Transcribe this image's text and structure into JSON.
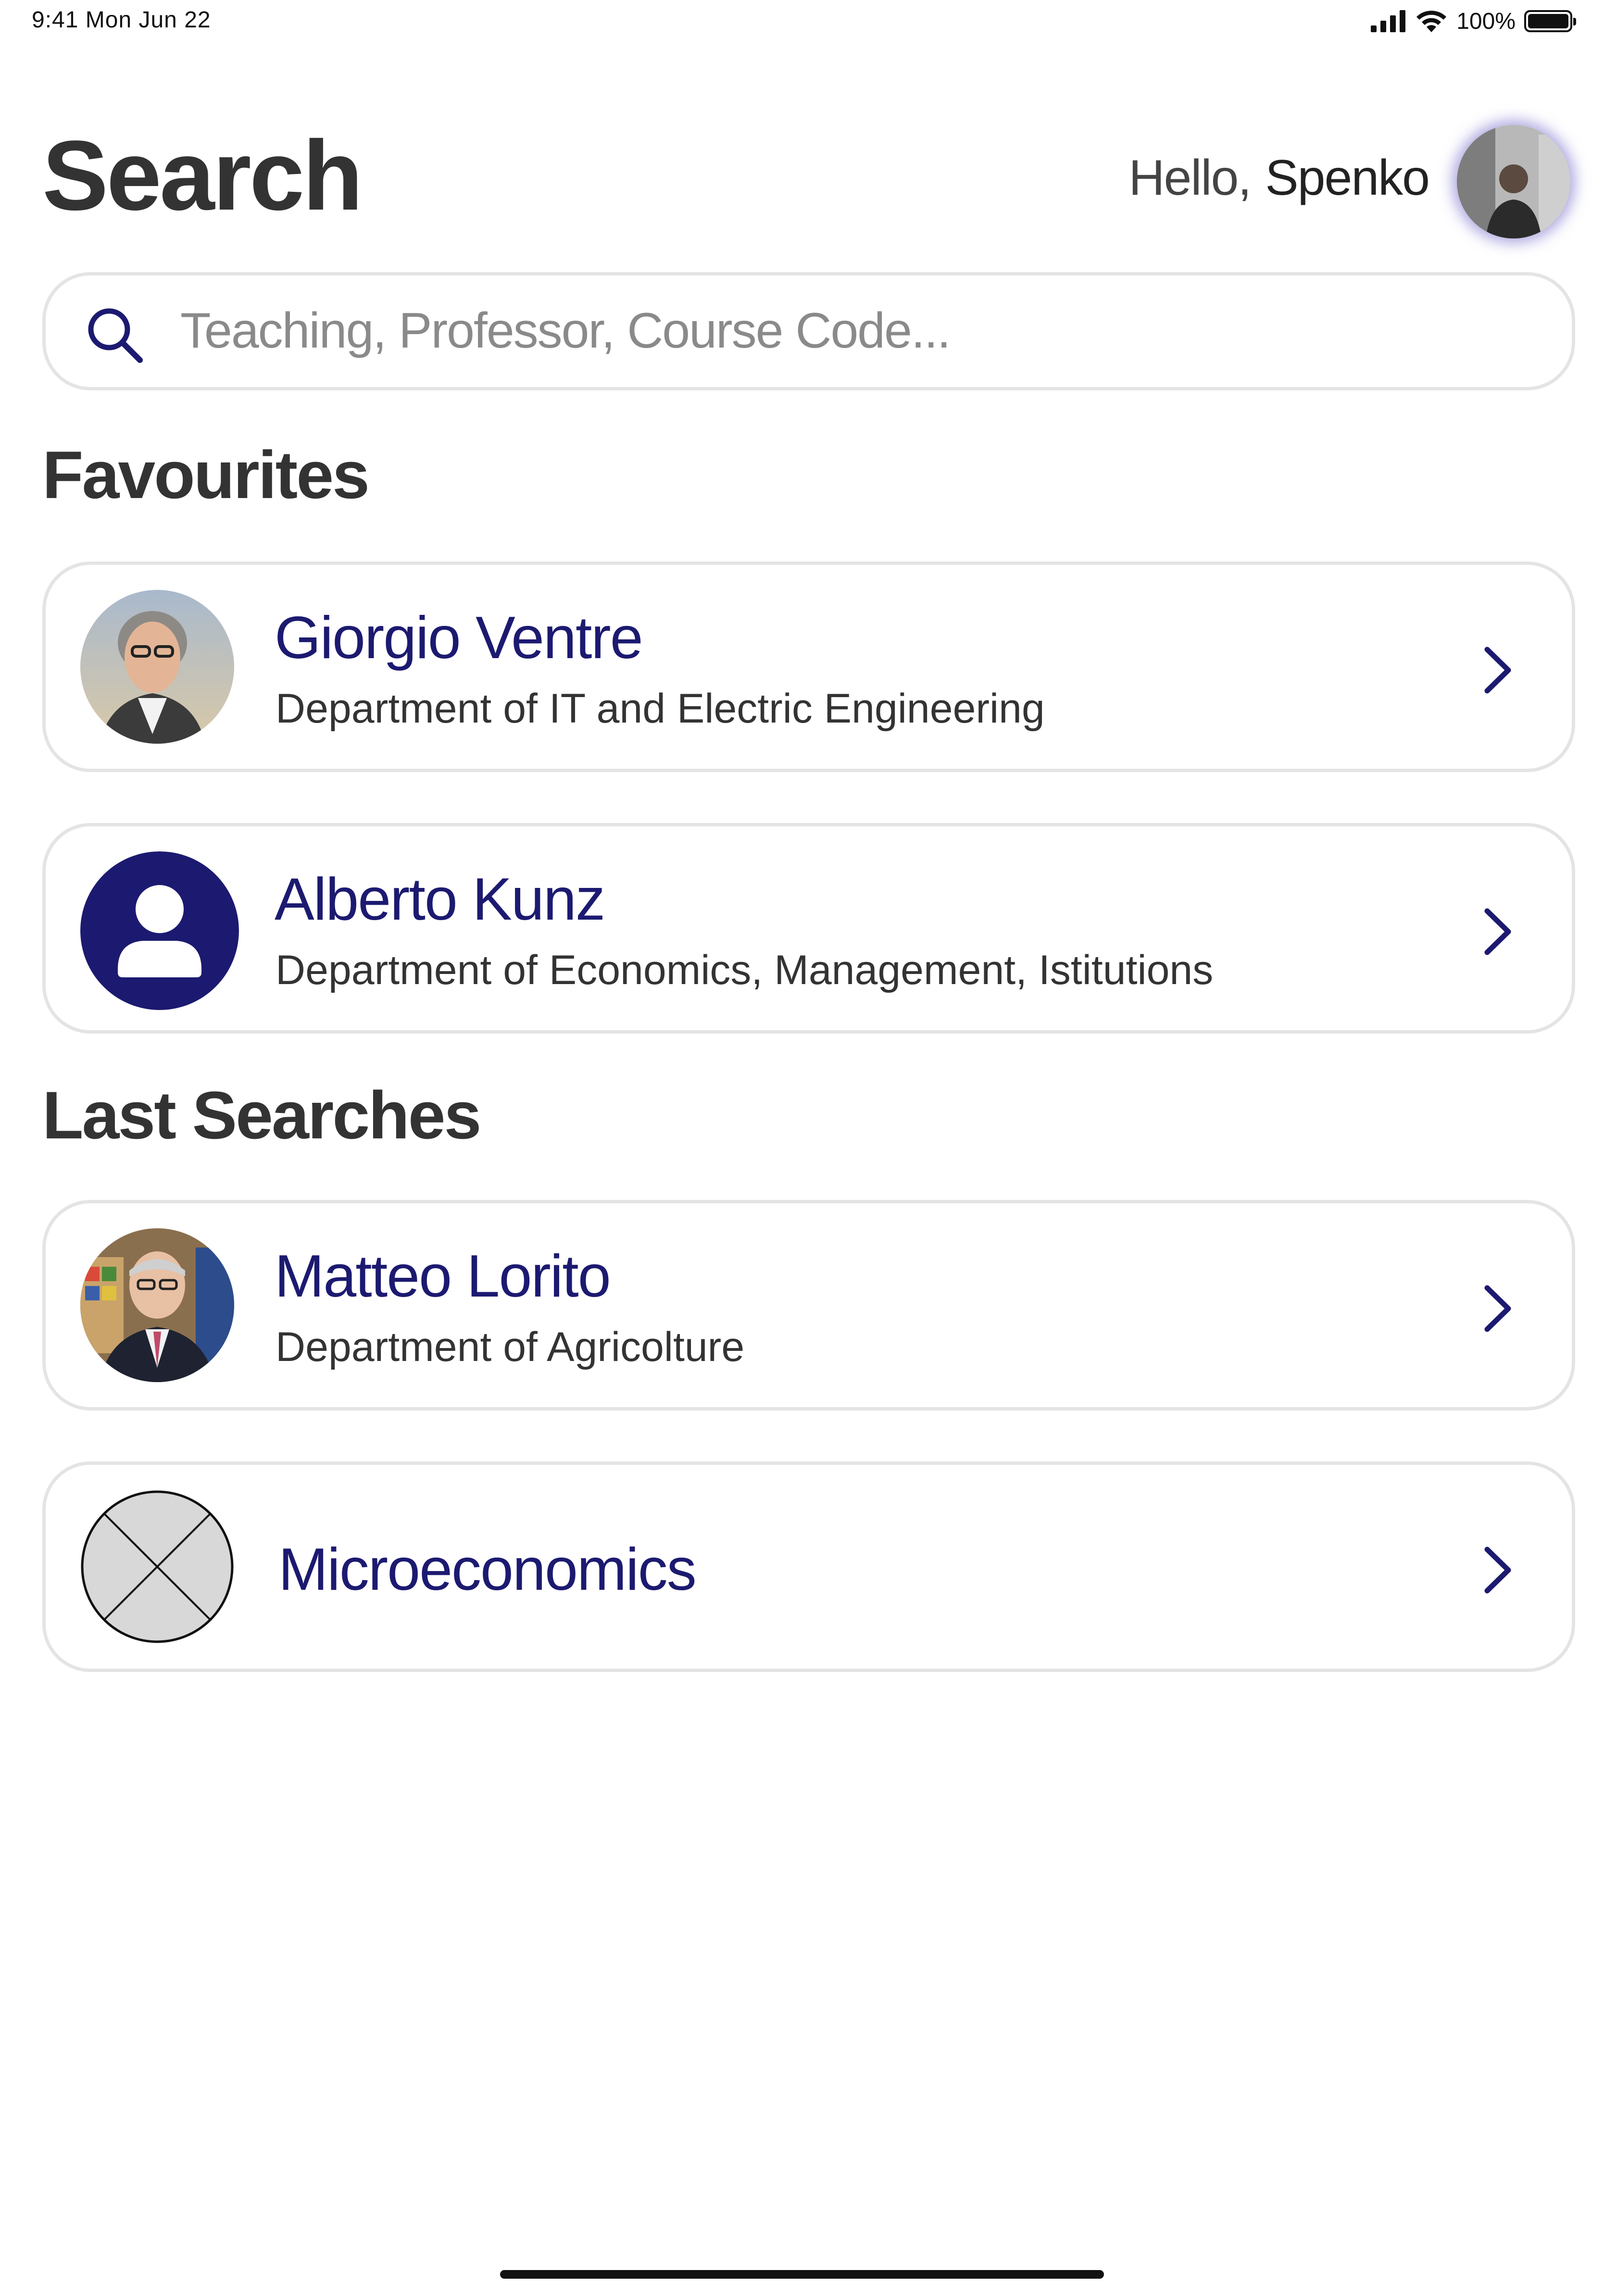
{
  "status_bar": {
    "time_date": "9:41  Mon Jun 22",
    "battery_pct": "100%",
    "battery_level": 1.0
  },
  "header": {
    "title": "Search",
    "greeting_prefix": "Hello,",
    "user_name": "Spenko",
    "avatar_icon": "user-photo"
  },
  "search": {
    "placeholder": "Teaching, Professor, Course Code...",
    "value": "",
    "icon": "search-icon",
    "accent": "#1c1a70"
  },
  "favourites": {
    "title": "Favourites",
    "items": [
      {
        "name": "Giorgio Ventre",
        "department": "Department of IT and Electric Engineering",
        "avatar": "professor-photo"
      },
      {
        "name": "Alberto Kunz",
        "department": "Department of Economics, Management, Istitutions",
        "avatar": "person-placeholder-icon"
      }
    ]
  },
  "last_searches": {
    "title": "Last Searches",
    "items": [
      {
        "name": "Matteo Lorito",
        "department": "Department of Agricolture",
        "avatar": "professor-photo"
      },
      {
        "name": "Microeconomics",
        "department": "",
        "avatar": "image-placeholder-icon"
      }
    ]
  },
  "colors": {
    "accent": "#1c1a70",
    "text": "#333333",
    "border": "#e4e4e4",
    "placeholder_text": "#8a8a8a"
  }
}
